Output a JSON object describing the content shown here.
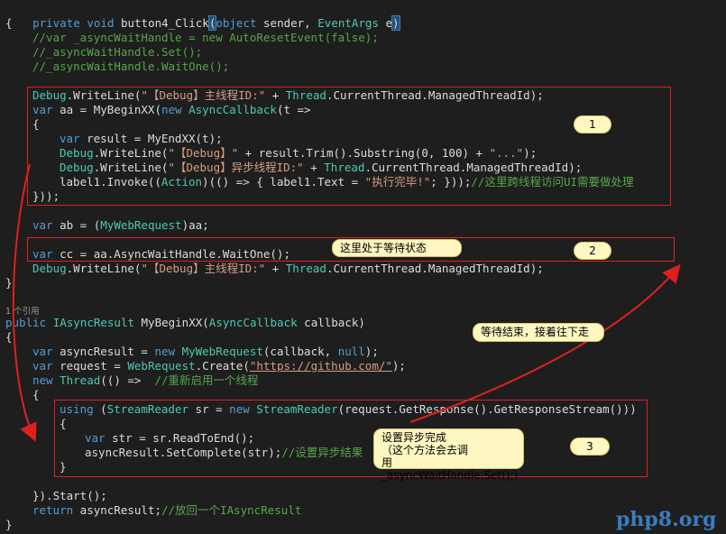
{
  "signature": {
    "kw1": "private",
    "kw2": "void",
    "name": "button4_Click",
    "paren_open": "(",
    "p1_type": "object",
    "p1_name": "sender,",
    "p2_type": "EventArgs",
    "p2_name": "e",
    "paren_close": ")"
  },
  "code": {
    "open_brace": "{",
    "c1": "//var _asyncWaitHandle = new AutoResetEvent(false);",
    "c2": "//_asyncWaitHandle.Set();",
    "c3": "//_asyncWaitHandle.WaitOne();",
    "l5": {
      "a": "Debug",
      "b": ".WriteLine(",
      "c": "\"【Debug】主线程ID:\"",
      "d": " + ",
      "e": "Thread",
      "f": ".CurrentThread.ManagedThreadId);"
    },
    "l6": {
      "a": "var",
      "b": " aa = MyBeginXX(",
      "c": "new",
      "d": " ",
      "e": "AsyncCallback",
      "f": "(t =>"
    },
    "l7": "{",
    "l8": {
      "a": "var",
      "b": " result = MyEndXX(t);"
    },
    "l9": {
      "a": "Debug",
      "b": ".WriteLine(",
      "c": "\"【Debug】\"",
      "d": " + result.Trim().Substring(0, 100) + ",
      "e": "\"...\"",
      "f": ");"
    },
    "l10": {
      "a": "Debug",
      "b": ".WriteLine(",
      "c": "\"【Debug】异步线程ID:\"",
      "d": " + ",
      "e": "Thread",
      "f": ".CurrentThread.ManagedThreadId);"
    },
    "l11": {
      "a": "label1.Invoke((",
      "b": "Action",
      "c": ")(() => { label1.Text = ",
      "d": "\"执行完毕!\"",
      "e": "; }));",
      "f": "//这里跨线程访问UI需要做处理"
    },
    "l12": "}));",
    "l13": {
      "a": "var",
      "b": " ab = (",
      "c": "MyWebRequest",
      "d": ")aa;"
    },
    "l14": {
      "a": "var",
      "b": " cc = aa.AsyncWaitHandle.WaitOne();"
    },
    "l15": {
      "a": "Debug",
      "b": ".WriteLine(",
      "c": "\"【Debug】主线程ID:\"",
      "d": " + ",
      "e": "Thread",
      "f": ".CurrentThread.ManagedThreadId);"
    },
    "l16": "}",
    "ref_count": "1 个引用",
    "l17": {
      "a": "public",
      "b": " ",
      "c": "IAsyncResult",
      "d": " MyBeginXX(",
      "e": "AsyncCallback",
      "f": " callback)"
    },
    "l18": "{",
    "l19": {
      "a": "var",
      "b": " asyncResult = ",
      "c": "new",
      "d": " ",
      "e": "MyWebRequest",
      "f": "(callback, ",
      "g": "null",
      "h": ");"
    },
    "l20": {
      "a": "var",
      "b": " request = ",
      "c": "WebRequest",
      "d": ".Create(",
      "e": "\"https://github.com/\"",
      "f": ");"
    },
    "l21": {
      "a": "new",
      "b": " ",
      "c": "Thread",
      "d": "(() =>  ",
      "e": "//重新启用一个线程"
    },
    "l22": "{",
    "l23": {
      "a": "using",
      "b": " (",
      "c": "StreamReader",
      "d": " sr = ",
      "e": "new",
      "f": " ",
      "g": "StreamReader",
      "h": "(request.GetResponse().GetResponseStream()))"
    },
    "l24": "{",
    "l25": {
      "a": "var",
      "b": " str = sr.ReadToEnd();"
    },
    "l26": {
      "a": "asyncResult.SetComplete(str);",
      "b": "//设置异步结果"
    },
    "l27": "}",
    "l28": "}).Start();",
    "l29": {
      "a": "return",
      "b": " asyncResult;",
      "c": "//放回一个IAsyncResult"
    },
    "l30": "}"
  },
  "annotations": {
    "badge1": "1",
    "badge2": "2",
    "badge3": "3",
    "note_wait": "这里处于等待状态",
    "note_done": "等待结束，接着往下走",
    "note_set_1": "设置异步完成",
    "note_set_2": "（这个方法会去调",
    "note_set_3": "用_asyncWaitHandle.Set();）"
  },
  "watermark": "php8.org",
  "colors": {
    "background": "#1e1e1e",
    "keyword": "#569cd6",
    "type": "#4ec9b0",
    "string": "#d69d85",
    "comment": "#57a64a",
    "highlight_box": "#e02020",
    "note_fill": "#fff7c2"
  }
}
